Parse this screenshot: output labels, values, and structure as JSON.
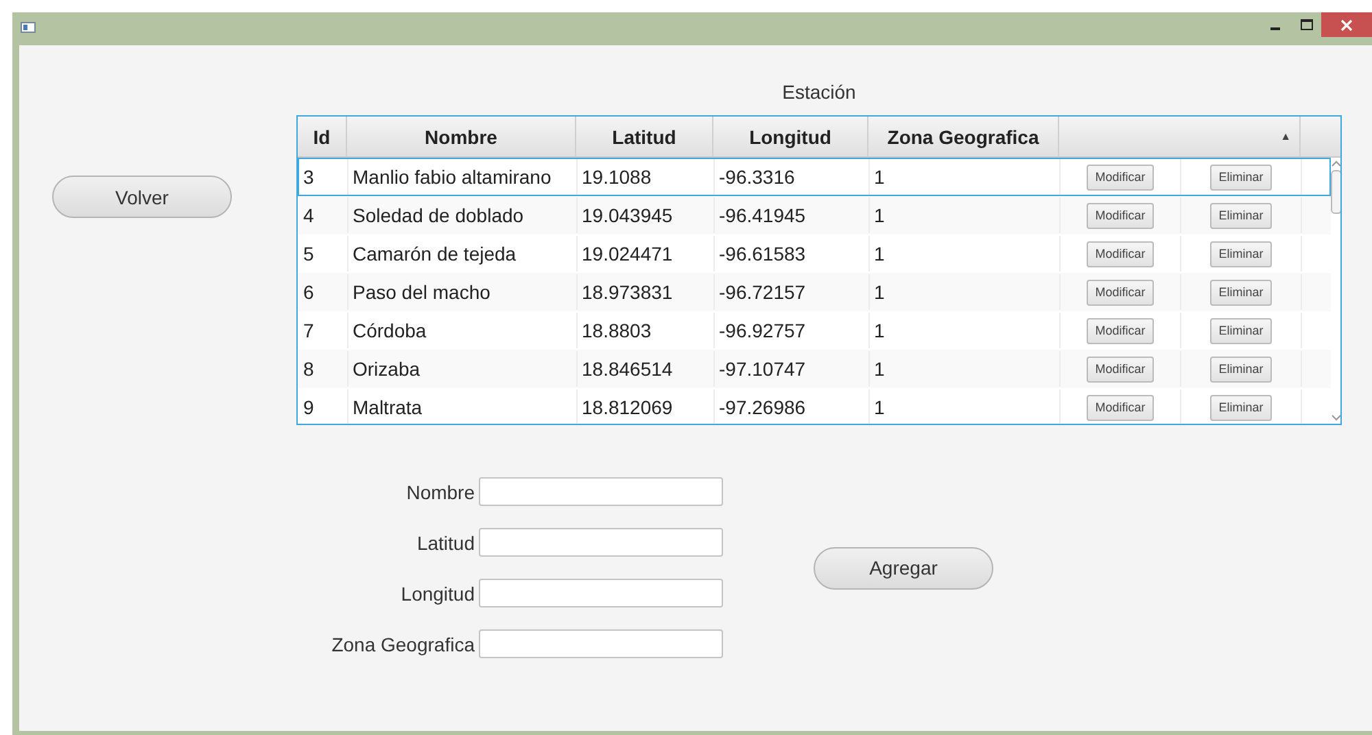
{
  "title": "Estación",
  "table": {
    "columns": [
      "Id",
      "Nombre",
      "Latitud",
      "Longitud",
      "Zona Geografica"
    ],
    "sort_indicator": "▲",
    "rows": [
      {
        "id": "3",
        "nombre": "Manlio fabio altamirano",
        "latitud": "19.1088",
        "longitud": "-96.3316",
        "zona": "1",
        "modify": "Modificar",
        "delete": "Eliminar",
        "selected": true
      },
      {
        "id": "4",
        "nombre": "Soledad de doblado",
        "latitud": "19.043945",
        "longitud": "-96.41945",
        "zona": "1",
        "modify": "Modificar",
        "delete": "Eliminar",
        "selected": false
      },
      {
        "id": "5",
        "nombre": "Camarón de tejeda",
        "latitud": "19.024471",
        "longitud": "-96.61583",
        "zona": "1",
        "modify": "Modificar",
        "delete": "Eliminar",
        "selected": false
      },
      {
        "id": "6",
        "nombre": "Paso del macho",
        "latitud": "18.973831",
        "longitud": "-96.72157",
        "zona": "1",
        "modify": "Modificar",
        "delete": "Eliminar",
        "selected": false
      },
      {
        "id": "7",
        "nombre": "Córdoba",
        "latitud": "18.8803",
        "longitud": "-96.92757",
        "zona": "1",
        "modify": "Modificar",
        "delete": "Eliminar",
        "selected": false
      },
      {
        "id": "8",
        "nombre": "Orizaba",
        "latitud": "18.846514",
        "longitud": "-97.10747",
        "zona": "1",
        "modify": "Modificar",
        "delete": "Eliminar",
        "selected": false
      },
      {
        "id": "9",
        "nombre": "Maltrata",
        "latitud": "18.812069",
        "longitud": "-97.26986",
        "zona": "1",
        "modify": "Modificar",
        "delete": "Eliminar",
        "selected": false
      }
    ]
  },
  "back_button": "Volver",
  "form": {
    "fields": [
      "Nombre",
      "Latitud",
      "Longitud",
      "Zona Geografica"
    ],
    "submit": "Agregar"
  }
}
